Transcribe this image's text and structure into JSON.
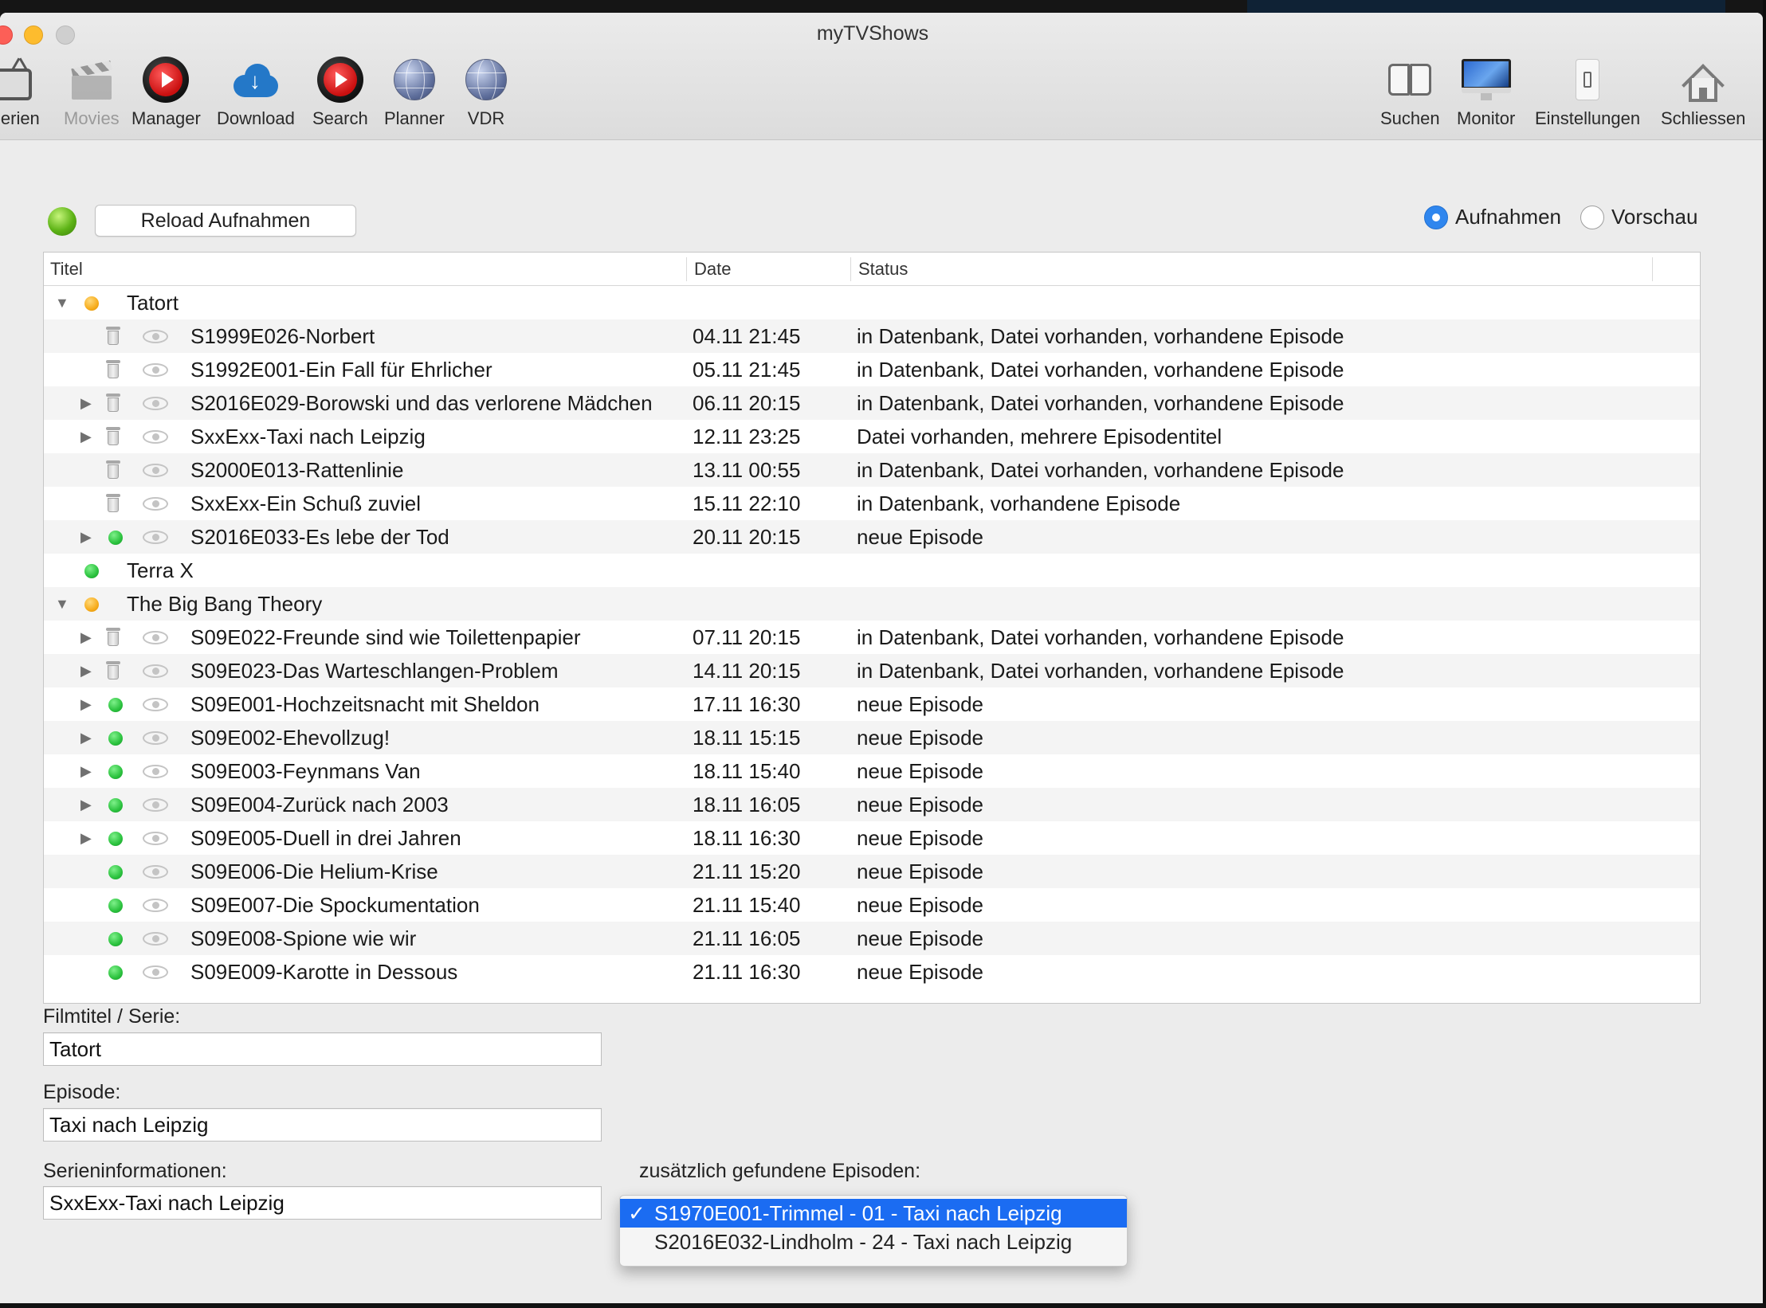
{
  "window": {
    "title": "myTVShows"
  },
  "toolbar": {
    "left": [
      {
        "label": "Serien",
        "icon": "tv-icon"
      },
      {
        "label": "Movies",
        "icon": "clapperboard-icon"
      },
      {
        "label": "Manager",
        "icon": "record-play-icon"
      },
      {
        "label": "Download",
        "icon": "cloud-download-icon"
      },
      {
        "label": "Search",
        "icon": "record-play-icon"
      },
      {
        "label": "Planner",
        "icon": "globe-icon"
      },
      {
        "label": "VDR",
        "icon": "globe-icon"
      }
    ],
    "right": [
      {
        "label": "Suchen",
        "icon": "book-icon"
      },
      {
        "label": "Monitor",
        "icon": "monitor-icon"
      },
      {
        "label": "Einstellungen",
        "icon": "switch-icon"
      },
      {
        "label": "Schliessen",
        "icon": "house-icon"
      }
    ]
  },
  "controls": {
    "reload_label": "Reload Aufnahmen",
    "status_color": "#5db316",
    "radio_recordings": "Aufnahmen",
    "radio_preview": "Vorschau",
    "selected_mode": "Aufnahmen"
  },
  "table": {
    "columns": [
      "Titel",
      "Date",
      "Status"
    ],
    "rows": [
      {
        "type": "group",
        "expanded": true,
        "led": "orange",
        "title": "Tatort"
      },
      {
        "type": "episode",
        "disclosure": false,
        "icon": "trash",
        "title": "S1999E026-Norbert",
        "date": "04.11  21:45",
        "status": "in Datenbank, Datei vorhanden, vorhandene Episode"
      },
      {
        "type": "episode",
        "disclosure": false,
        "icon": "trash",
        "title": "S1992E001-Ein Fall für Ehrlicher",
        "date": "05.11  21:45",
        "status": "in Datenbank, Datei vorhanden, vorhandene Episode"
      },
      {
        "type": "episode",
        "disclosure": true,
        "icon": "trash",
        "title": "S2016E029-Borowski und das verlorene Mädchen",
        "date": "06.11  20:15",
        "status": "in Datenbank, Datei vorhanden, vorhandene Episode"
      },
      {
        "type": "episode",
        "disclosure": true,
        "icon": "trash",
        "title": "SxxExx-Taxi nach Leipzig",
        "date": "12.11  23:25",
        "status": "Datei vorhanden, mehrere Episodentitel"
      },
      {
        "type": "episode",
        "disclosure": false,
        "icon": "trash",
        "title": "S2000E013-Rattenlinie",
        "date": "13.11  00:55",
        "status": "in Datenbank, Datei vorhanden, vorhandene Episode"
      },
      {
        "type": "episode",
        "disclosure": false,
        "icon": "trash",
        "title": "SxxExx-Ein Schuß zuviel",
        "date": "15.11  22:10",
        "status": "in Datenbank, vorhandene Episode"
      },
      {
        "type": "episode",
        "disclosure": true,
        "icon": "green",
        "title": "S2016E033-Es lebe der Tod",
        "date": "20.11  20:15",
        "status": "neue Episode"
      },
      {
        "type": "group",
        "expanded": false,
        "led": "green",
        "title": "Terra X"
      },
      {
        "type": "group",
        "expanded": true,
        "led": "orange",
        "title": "The Big Bang Theory"
      },
      {
        "type": "episode",
        "disclosure": true,
        "icon": "trash",
        "title": "S09E022-Freunde sind wie Toilettenpapier",
        "date": "07.11  20:15",
        "status": "in Datenbank, Datei vorhanden, vorhandene Episode"
      },
      {
        "type": "episode",
        "disclosure": true,
        "icon": "trash",
        "title": "S09E023-Das Warteschlangen-Problem",
        "date": "14.11  20:15",
        "status": "in Datenbank, Datei vorhanden, vorhandene Episode"
      },
      {
        "type": "episode",
        "disclosure": true,
        "icon": "green",
        "title": "S09E001-Hochzeitsnacht mit Sheldon",
        "date": "17.11  16:30",
        "status": "neue Episode"
      },
      {
        "type": "episode",
        "disclosure": true,
        "icon": "green",
        "title": "S09E002-Ehevollzug!",
        "date": "18.11  15:15",
        "status": "neue Episode"
      },
      {
        "type": "episode",
        "disclosure": true,
        "icon": "green",
        "title": "S09E003-Feynmans Van",
        "date": "18.11  15:40",
        "status": "neue Episode"
      },
      {
        "type": "episode",
        "disclosure": true,
        "icon": "green",
        "title": "S09E004-Zurück nach 2003",
        "date": "18.11  16:05",
        "status": "neue Episode"
      },
      {
        "type": "episode",
        "disclosure": true,
        "icon": "green",
        "title": "S09E005-Duell in drei Jahren",
        "date": "18.11  16:30",
        "status": "neue Episode"
      },
      {
        "type": "episode",
        "disclosure": false,
        "icon": "green",
        "title": "S09E006-Die Helium-Krise",
        "date": "21.11  15:20",
        "status": "neue Episode"
      },
      {
        "type": "episode",
        "disclosure": false,
        "icon": "green",
        "title": "S09E007-Die Spockumentation",
        "date": "21.11  15:40",
        "status": "neue Episode"
      },
      {
        "type": "episode",
        "disclosure": false,
        "icon": "green",
        "title": "S09E008-Spione wie wir",
        "date": "21.11  16:05",
        "status": "neue Episode"
      },
      {
        "type": "episode",
        "disclosure": false,
        "icon": "green",
        "title": "S09E009-Karotte in Dessous",
        "date": "21.11  16:30",
        "status": "neue Episode"
      }
    ]
  },
  "form": {
    "film_label": "Filmtitel / Serie:",
    "film_value": "Tatort",
    "episode_label": "Episode:",
    "episode_value": "Taxi nach Leipzig",
    "series_info_label": "Serieninformationen:",
    "series_info_value": "SxxExx-Taxi nach Leipzig",
    "extra_label": "zusätzlich gefundene Episoden:",
    "extra_options": [
      {
        "label": "S1970E001-Trimmel - 01 - Taxi nach Leipzig",
        "selected": true
      },
      {
        "label": "S2016E032-Lindholm - 24 - Taxi nach Leipzig",
        "selected": false
      }
    ],
    "check_glyph": "✓"
  }
}
